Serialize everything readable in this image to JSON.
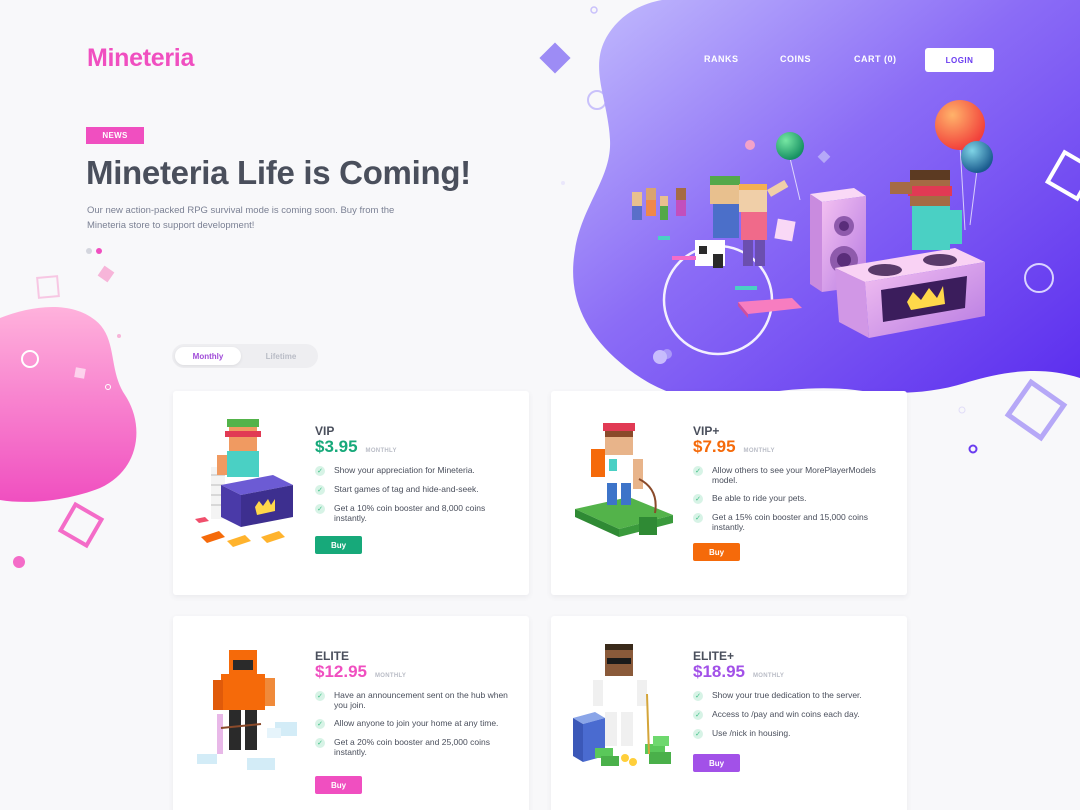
{
  "brand": {
    "name": "Mineteria",
    "accent": "#f04fc0",
    "hero_gradient": [
      "#b9b0ff",
      "#6a3cf0"
    ]
  },
  "nav": {
    "ranks": "RANKS",
    "coins": "COINS",
    "cart": "CART (0)",
    "login": "LOGIN"
  },
  "hero": {
    "badge": "NEWS",
    "title": "Mineteria Life is Coming!",
    "description": "Our new action-packed RPG survival mode is coming soon. Buy from the Mineteria store to support development!",
    "slides": 2,
    "active_slide": 2
  },
  "billing_toggle": {
    "options": [
      "Monthly",
      "Lifetime"
    ],
    "selected": "Monthly"
  },
  "plans": [
    {
      "name": "VIP",
      "price": "$3.95",
      "period": "MONTHLY",
      "color": "#17a97a",
      "features": [
        "Show your appreciation for Mineteria.",
        "Start games of tag and hide-and-seek.",
        "Get a 10% coin booster and 8,000 coins instantly."
      ],
      "buy": "Buy"
    },
    {
      "name": "VIP+",
      "price": "$7.95",
      "period": "MONTHLY",
      "color": "#f56a0a",
      "features": [
        "Allow others to see your MorePlayerModels model.",
        "Be able to ride your pets.",
        "Get a 15% coin booster and 15,000 coins instantly."
      ],
      "buy": "Buy"
    },
    {
      "name": "ELITE",
      "price": "$12.95",
      "period": "MONTHLY",
      "color": "#f04fc0",
      "features": [
        "Have an announcement sent on the hub when you join.",
        "Allow anyone to join your home at any time.",
        "Get a 20% coin booster and 25,000 coins instantly."
      ],
      "buy": "Buy"
    },
    {
      "name": "ELITE+",
      "price": "$18.95",
      "period": "MONTHLY",
      "color": "#a251e8",
      "features": [
        "Show your true dedication to the server.",
        "Access to /pay and win coins each day.",
        "Use /nick in housing."
      ],
      "buy": "Buy"
    }
  ]
}
